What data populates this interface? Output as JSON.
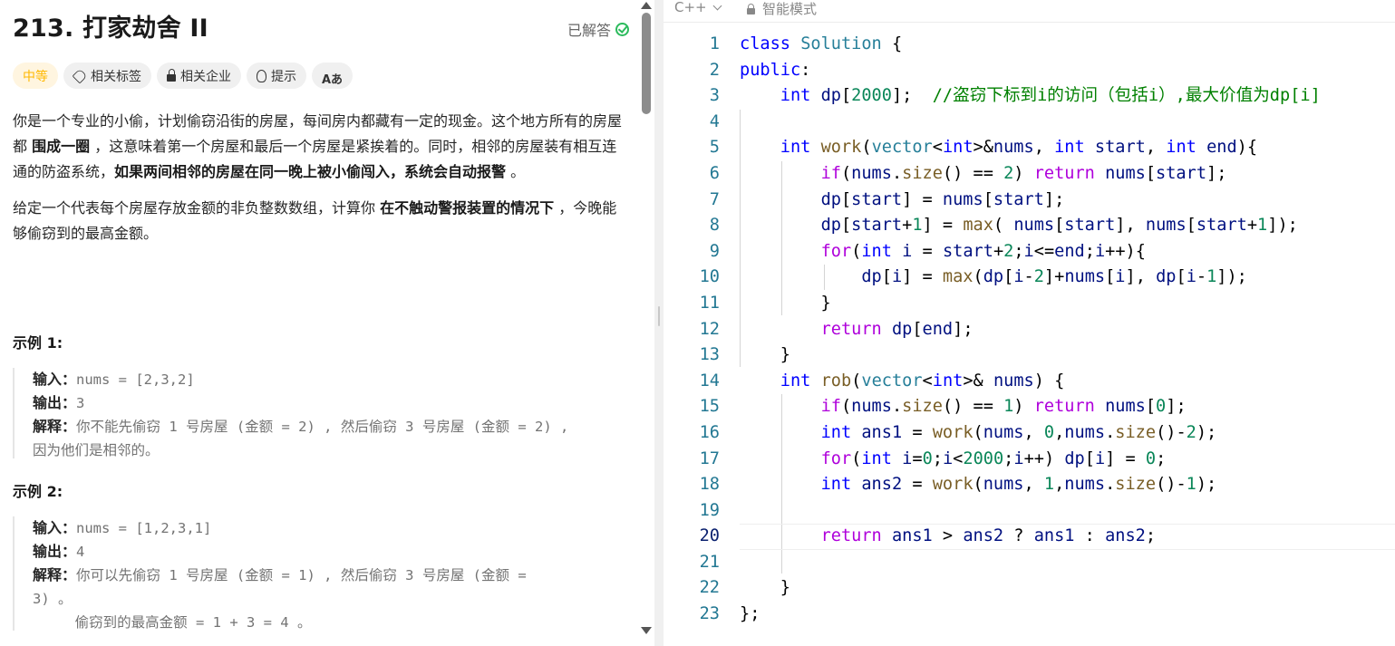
{
  "problem": {
    "title": "213. 打家劫舍 II",
    "status_label": "已解答",
    "difficulty": "中等",
    "tags": [
      "相关标签",
      "相关企业",
      "提示",
      "Aあ"
    ],
    "desc_p1_a": "你是一个专业的小偷，计划偷窃沿街的房屋，每间房内都藏有一定的现金。这个地方所有的房屋都 ",
    "desc_p1_b1": "围成一圈",
    "desc_p1_c": " ，这意味着第一个房屋和最后一个房屋是紧挨着的。同时，相邻的房屋装有相互连通的防盗系统，",
    "desc_p1_b2": "如果两间相邻的房屋在同一晚上被小偷闯入，系统会自动报警",
    "desc_p1_d": " 。",
    "desc_p2_a": "给定一个代表每个房屋存放金额的非负整数数组，计算你 ",
    "desc_p2_b": "在不触动警报装置的情况下",
    "desc_p2_c": " ，今晚能够偷窃到的最高金额。",
    "examples": [
      {
        "title": "示例 1:",
        "input_label": "输入：",
        "input": "nums = [2,3,2]",
        "output_label": "输出：",
        "output": "3",
        "explain_label": "解释：",
        "explain_1": "你不能先偷窃 1 号房屋 (金额 = 2) , 然后偷窃 3 号房屋 (金额 = 2) ,",
        "explain_2": "因为他们是相邻的。"
      },
      {
        "title": "示例 2:",
        "input_label": "输入：",
        "input": "nums = [1,2,3,1]",
        "output_label": "输出：",
        "output": "4",
        "explain_label": "解释：",
        "explain_1": "你可以先偷窃 1 号房屋 (金额 = 1) , 然后偷窃 3 号房屋 (金额 =",
        "explain_2": "3) 。",
        "explain_3": "     偷窃到的最高金额 = 1 + 3 = 4 。"
      }
    ]
  },
  "editor": {
    "language": "C++",
    "mode": "智能模式",
    "active_line": 20,
    "line_numbers": [
      "1",
      "2",
      "3",
      "4",
      "5",
      "6",
      "7",
      "8",
      "9",
      "10",
      "11",
      "12",
      "13",
      "14",
      "15",
      "16",
      "17",
      "18",
      "19",
      "20",
      "21",
      "22",
      "23"
    ],
    "code_lines": [
      "class Solution {",
      "public:",
      "    int dp[2000];  //盗窃下标到i的访问（包括i）,最大价值为dp[i]",
      "",
      "    int work(vector<int>&nums, int start, int end){",
      "        if(nums.size() == 2) return nums[start];",
      "        dp[start] = nums[start];",
      "        dp[start+1] = max( nums[start], nums[start+1]);",
      "        for(int i = start+2;i<=end;i++){",
      "            dp[i] = max(dp[i-2]+nums[i], dp[i-1]);",
      "        }",
      "        return dp[end];",
      "    }",
      "    int rob(vector<int>& nums) {",
      "        if(nums.size() == 1) return nums[0];",
      "        int ans1 = work(nums, 0,nums.size()-2);",
      "        for(int i=0;i<2000;i++) dp[i] = 0;",
      "        int ans2 = work(nums, 1,nums.size()-1);",
      "",
      "        return ans1 > ans2 ? ans1 : ans2;",
      "",
      "    }",
      "};"
    ]
  },
  "colors": {
    "keyword": "#0000ff",
    "type": "#267f99",
    "control": "#af00db",
    "number": "#098658",
    "function": "#795e26",
    "variable": "#001080",
    "comment": "#008000",
    "difficulty_medium": "#ffb800",
    "solved_green": "#2cbb5d"
  }
}
